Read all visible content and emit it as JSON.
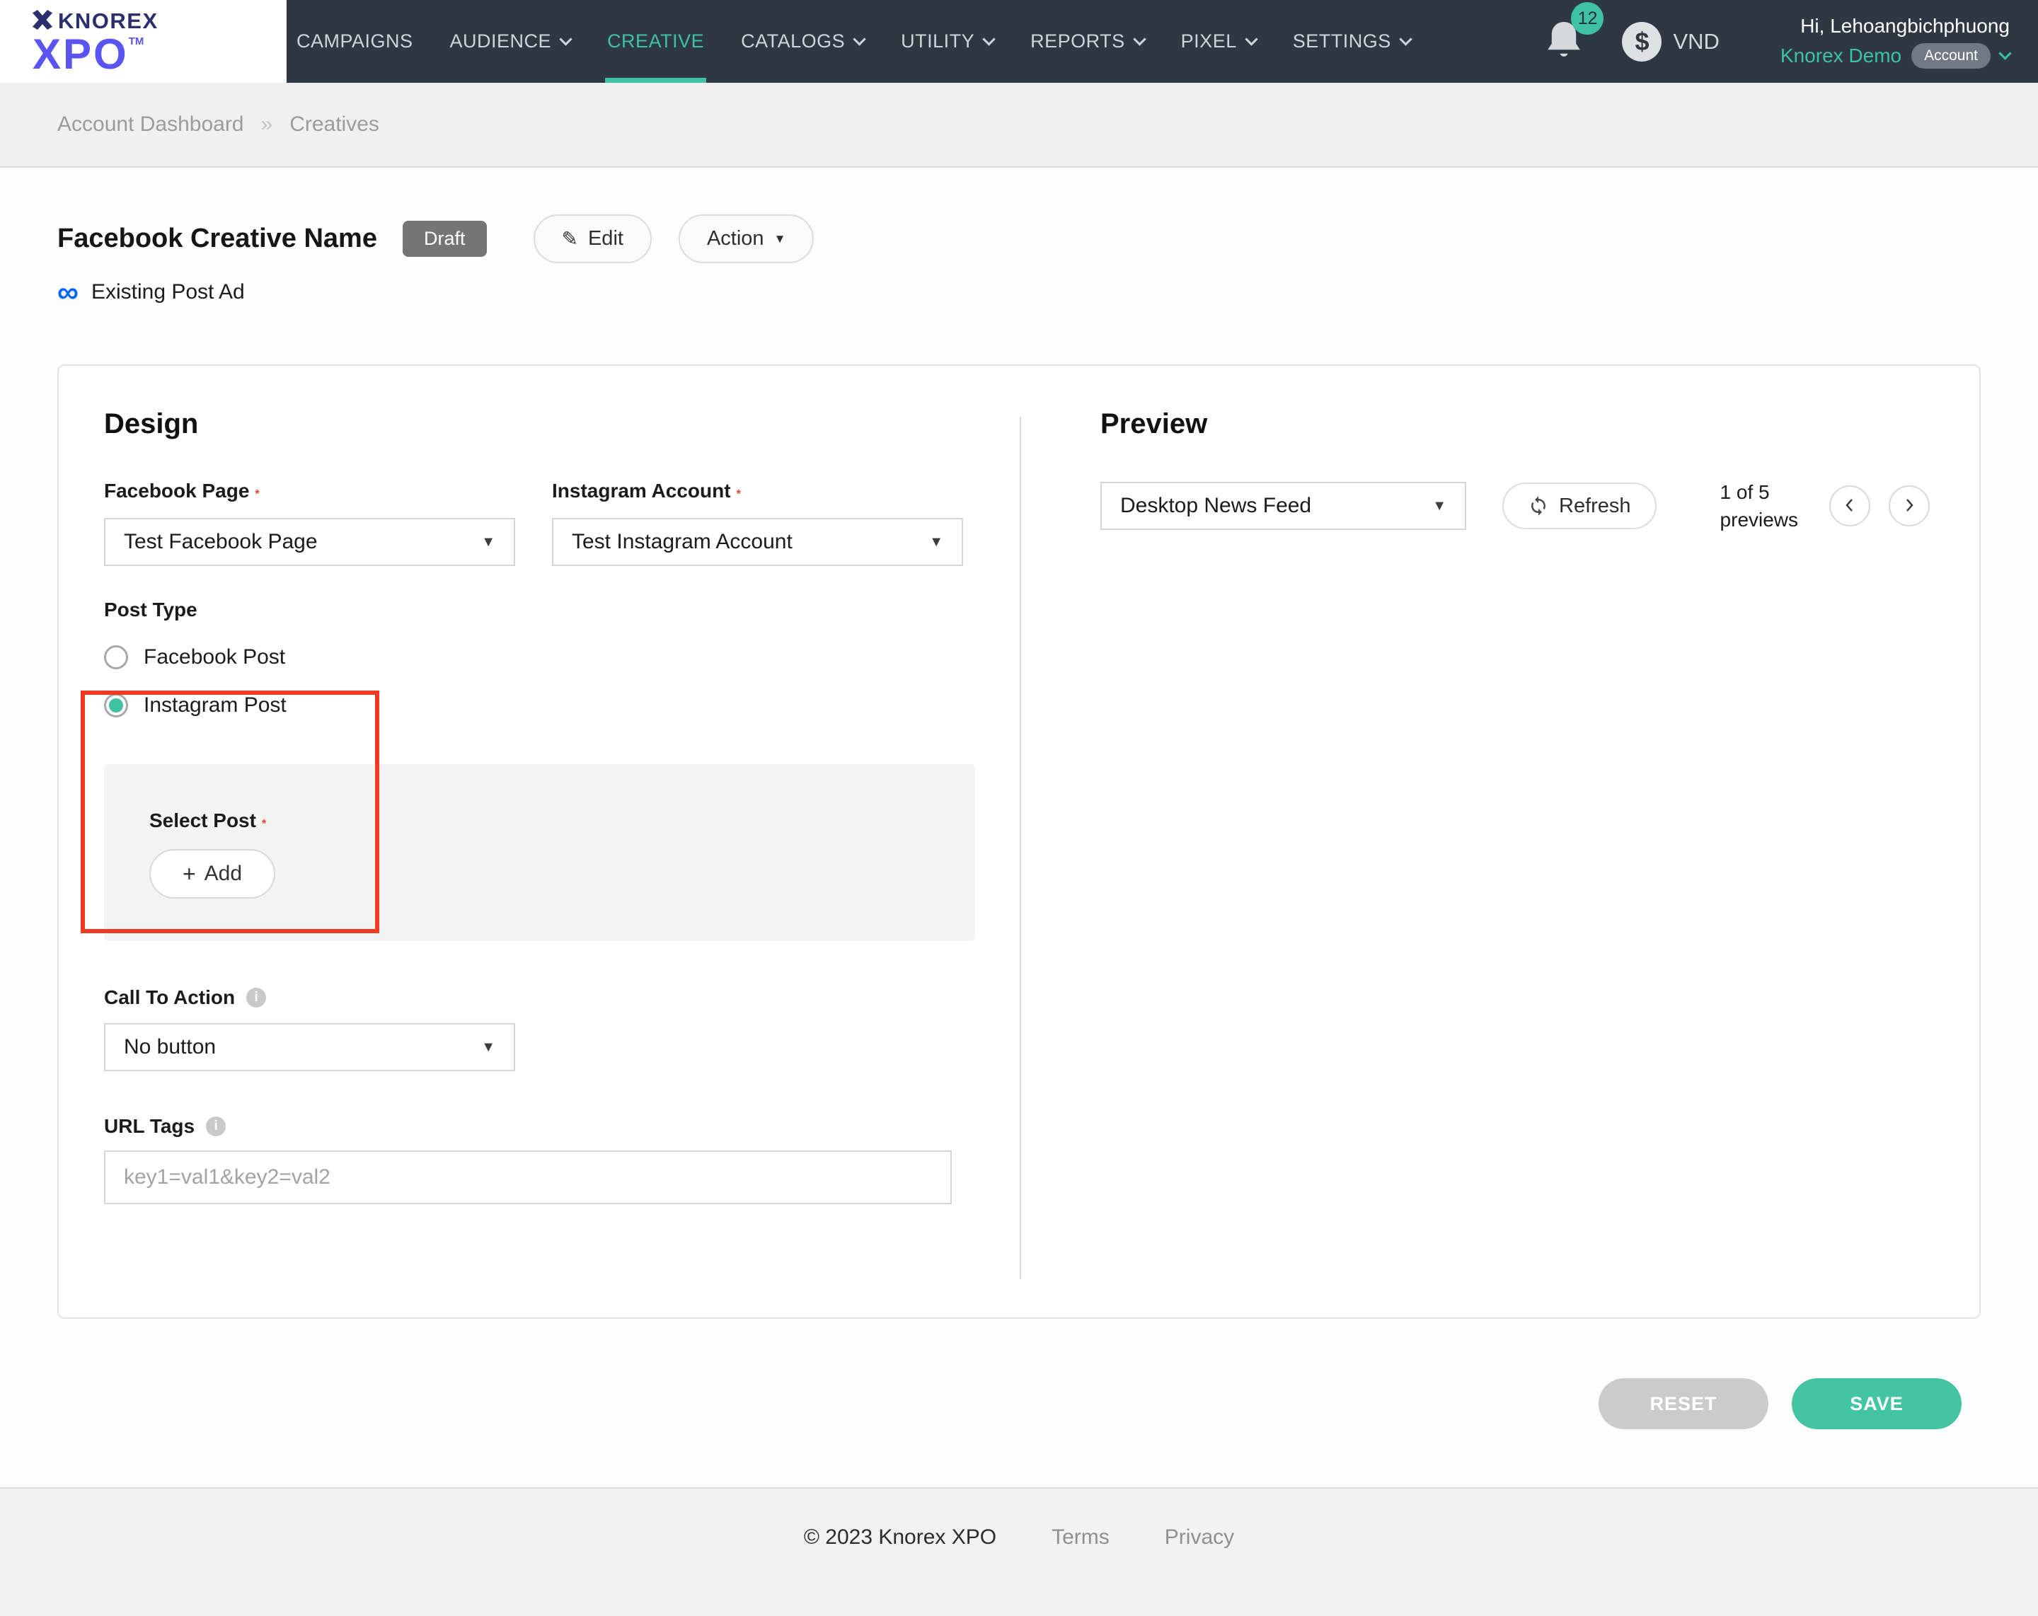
{
  "logo": {
    "brand": "KNOREX",
    "product": "XPO",
    "tm": "TM"
  },
  "nav": {
    "items": [
      {
        "label": "CAMPAIGNS"
      },
      {
        "label": "AUDIENCE"
      },
      {
        "label": "CREATIVE"
      },
      {
        "label": "CATALOGS"
      },
      {
        "label": "UTILITY"
      },
      {
        "label": "REPORTS"
      },
      {
        "label": "PIXEL"
      },
      {
        "label": "SETTINGS"
      }
    ],
    "notification_count": "12",
    "currency": "VND",
    "greeting": "Hi, Lehoangbichphuong",
    "account_name": "Knorex Demo",
    "account_badge": "Account"
  },
  "breadcrumb": {
    "items": [
      "Account Dashboard",
      "Creatives"
    ],
    "separator": "»"
  },
  "header": {
    "title": "Facebook Creative Name",
    "status": "Draft",
    "edit": "Edit",
    "action": "Action",
    "ad_type": "Existing Post Ad"
  },
  "design": {
    "heading": "Design",
    "facebook_page": {
      "label": "Facebook Page",
      "required": "*",
      "value": "Test Facebook Page"
    },
    "instagram_account": {
      "label": "Instagram Account",
      "required": "*",
      "value": "Test Instagram Account"
    },
    "post_type": {
      "label": "Post Type",
      "options": [
        {
          "label": "Facebook Post",
          "selected": false
        },
        {
          "label": "Instagram Post",
          "selected": true
        }
      ]
    },
    "select_post": {
      "label": "Select Post",
      "required": "*",
      "add_button": "Add"
    },
    "call_to_action": {
      "label": "Call To Action",
      "value": "No button"
    },
    "url_tags": {
      "label": "URL Tags",
      "placeholder": "key1=val1&key2=val2"
    }
  },
  "preview": {
    "heading": "Preview",
    "device": "Desktop News Feed",
    "refresh": "Refresh",
    "page_indicator": "1 of 5",
    "page_indicator_sub": "previews"
  },
  "footer_actions": {
    "reset": "RESET",
    "save": "SAVE"
  },
  "footer": {
    "copyright": "© 2023 Knorex XPO",
    "terms": "Terms",
    "privacy": "Privacy"
  },
  "colors": {
    "accent_teal": "#3FC1A4",
    "highlight_red": "#EE3B23",
    "status_gray": "#757575",
    "meta_blue": "#0866FF",
    "nav_dark": "#2D3843"
  }
}
